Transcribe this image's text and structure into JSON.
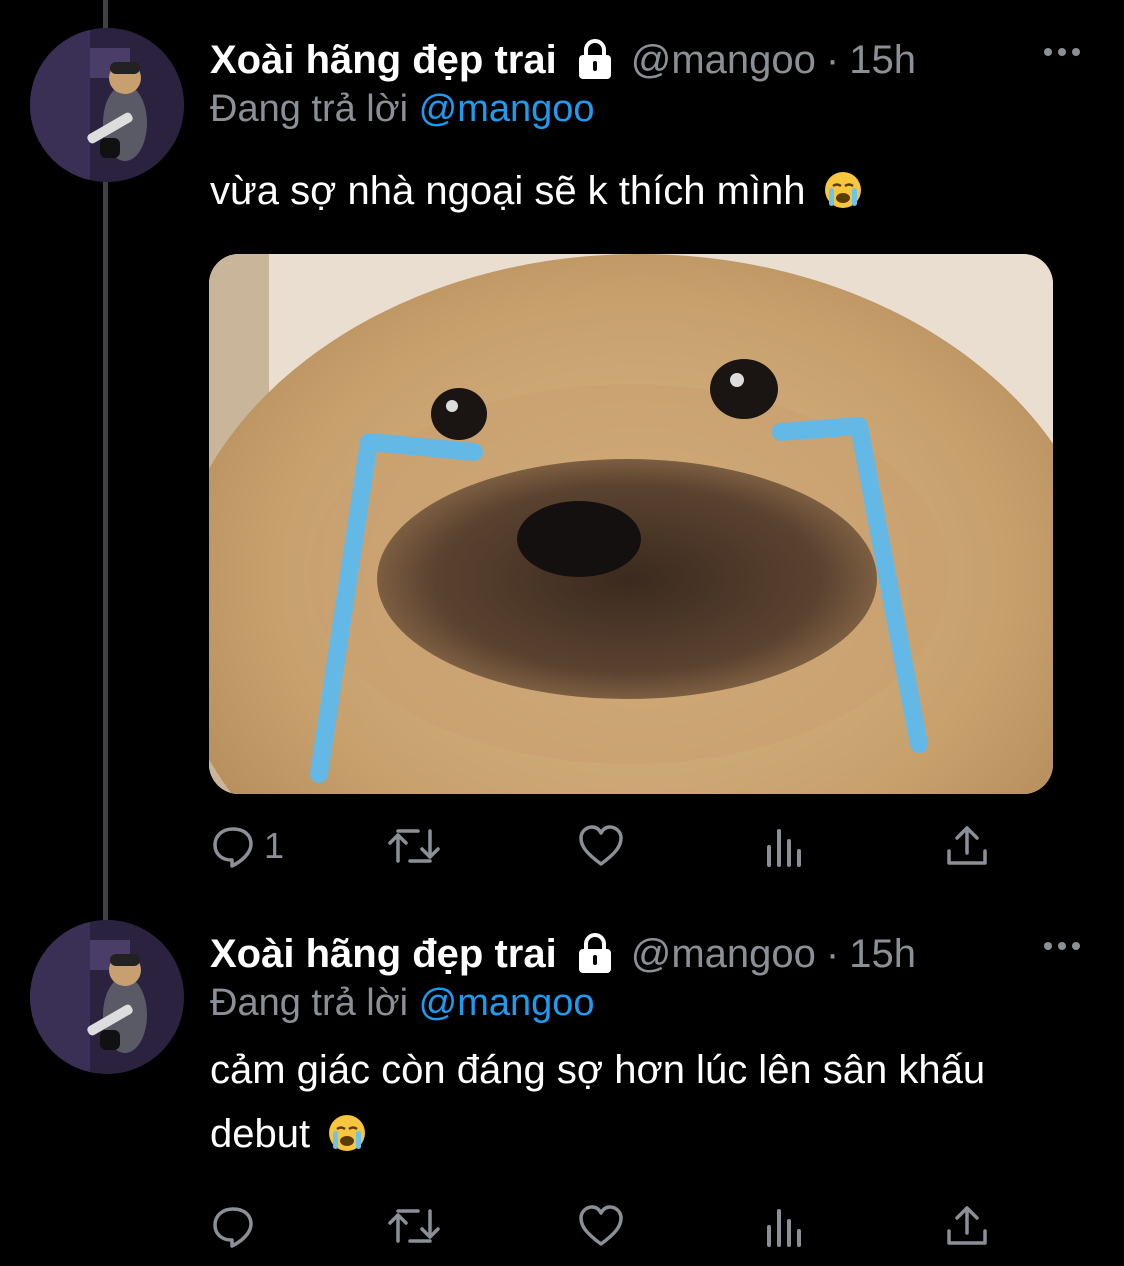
{
  "tweets": [
    {
      "display_name": "Xoài hãng đẹp trai",
      "handle": "@mangoo",
      "separator": "·",
      "time": "15h",
      "replying_label": "Đang trả lời",
      "replying_to": "@mangoo",
      "text": "vừa sợ nhà ngoại sẽ k thích mình",
      "emoji": "loudly-crying-face",
      "has_media": true,
      "actions": {
        "reply_count": "1"
      }
    },
    {
      "display_name": "Xoài hãng đẹp trai",
      "handle": "@mangoo",
      "separator": "·",
      "time": "15h",
      "replying_label": "Đang trả lời",
      "replying_to": "@mangoo",
      "text": "cảm giác còn đáng sợ hơn lúc lên sân khấu debut",
      "emoji": "loudly-crying-face",
      "has_media": false,
      "actions": {
        "reply_count": ""
      }
    }
  ],
  "icons": [
    "lock-icon",
    "more-icon",
    "reply-icon",
    "retweet-icon",
    "like-icon",
    "analytics-icon",
    "share-icon"
  ],
  "colors": {
    "background": "#000000",
    "text": "#ffffff",
    "muted": "#8b9096",
    "link": "#1d9bf0",
    "thread_line": "#3f4245"
  }
}
